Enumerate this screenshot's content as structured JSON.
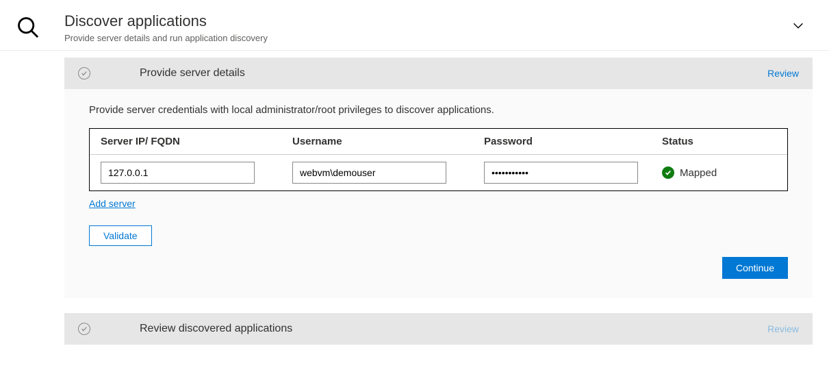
{
  "header": {
    "title": "Discover applications",
    "subtitle": "Provide server details and run application discovery"
  },
  "section1": {
    "title": "Provide server details",
    "review_label": "Review",
    "instructions": "Provide server credentials with local administrator/root privileges to discover applications.",
    "columns": {
      "ip": "Server IP/ FQDN",
      "username": "Username",
      "password": "Password",
      "status": "Status"
    },
    "rows": [
      {
        "ip": "127.0.0.1",
        "username": "webvm\\demouser",
        "password_display": "•••••••••••",
        "status_label": "Mapped"
      }
    ],
    "add_server_label": "Add server",
    "validate_label": "Validate",
    "continue_label": "Continue"
  },
  "section2": {
    "title": "Review discovered applications",
    "review_label": "Review"
  }
}
